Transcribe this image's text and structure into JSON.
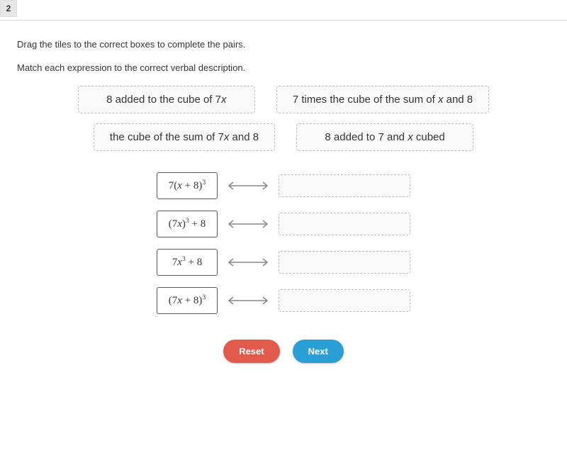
{
  "question_number": "2",
  "instruction1": "Drag the tiles to the correct boxes to complete the pairs.",
  "instruction2": "Match each expression to the correct verbal description.",
  "tiles": {
    "t0": {
      "pre": "8 added to the cube of 7",
      "var": "x",
      "post": ""
    },
    "t1": {
      "pre": "7 times the cube of the sum of ",
      "var": "x",
      "post": " and 8"
    },
    "t2": {
      "pre": "the cube of the sum of 7",
      "var": "x",
      "post": " and 8"
    },
    "t3": {
      "pre": "8 added to 7 and ",
      "var": "x",
      "post": " cubed"
    }
  },
  "expressions": {
    "e0": "7(x + 8)^3",
    "e1": "(7x)^3 + 8",
    "e2": "7x^3 + 8",
    "e3": "(7x + 8)^3"
  },
  "buttons": {
    "reset": "Reset",
    "next": "Next"
  }
}
